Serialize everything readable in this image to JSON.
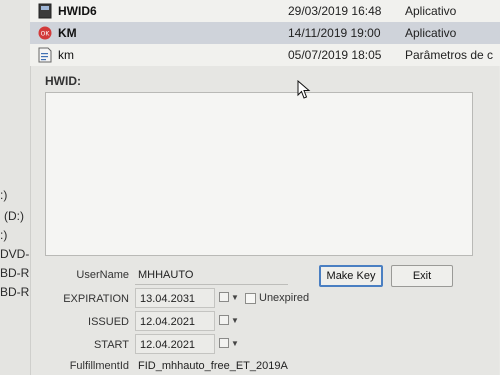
{
  "sidebar": {
    "drives": [
      ":)",
      "(D:)",
      ":)",
      "DVD-RW",
      "BD-ROM",
      "BD-ROM"
    ]
  },
  "files": [
    {
      "name": "HWID6",
      "date": "29/03/2019 16:48",
      "type": "Aplicativo",
      "icon": "exe-app-icon"
    },
    {
      "name": "KM",
      "date": "14/11/2019 19:00",
      "type": "Aplicativo",
      "icon": "red-app-icon"
    },
    {
      "name": "km",
      "date": "05/07/2019 18:05",
      "type": "Parâmetros de c",
      "icon": "config-file-icon"
    }
  ],
  "dialog": {
    "hwid_label": "HWID:",
    "hwid_value": "",
    "username_label": "UserName",
    "username_value": "MHHAUTO",
    "expiration_label": "EXPIRATION",
    "expiration_value": "13.04.2031",
    "unexpired_label": "Unexpired",
    "unexpired_checked": false,
    "issued_label": "ISSUED",
    "issued_value": "12.04.2021",
    "start_label": "START",
    "start_value": "12.04.2021",
    "fulfillment_label": "FulfillmentId",
    "fulfillment_value": "FID_mhhauto_free_ET_2019A",
    "make_key_label": "Make Key",
    "exit_label": "Exit"
  },
  "colors": {
    "selection": "#cfd3da",
    "primary_border": "#4a7fc2",
    "km_icon": "#d23a3a"
  }
}
